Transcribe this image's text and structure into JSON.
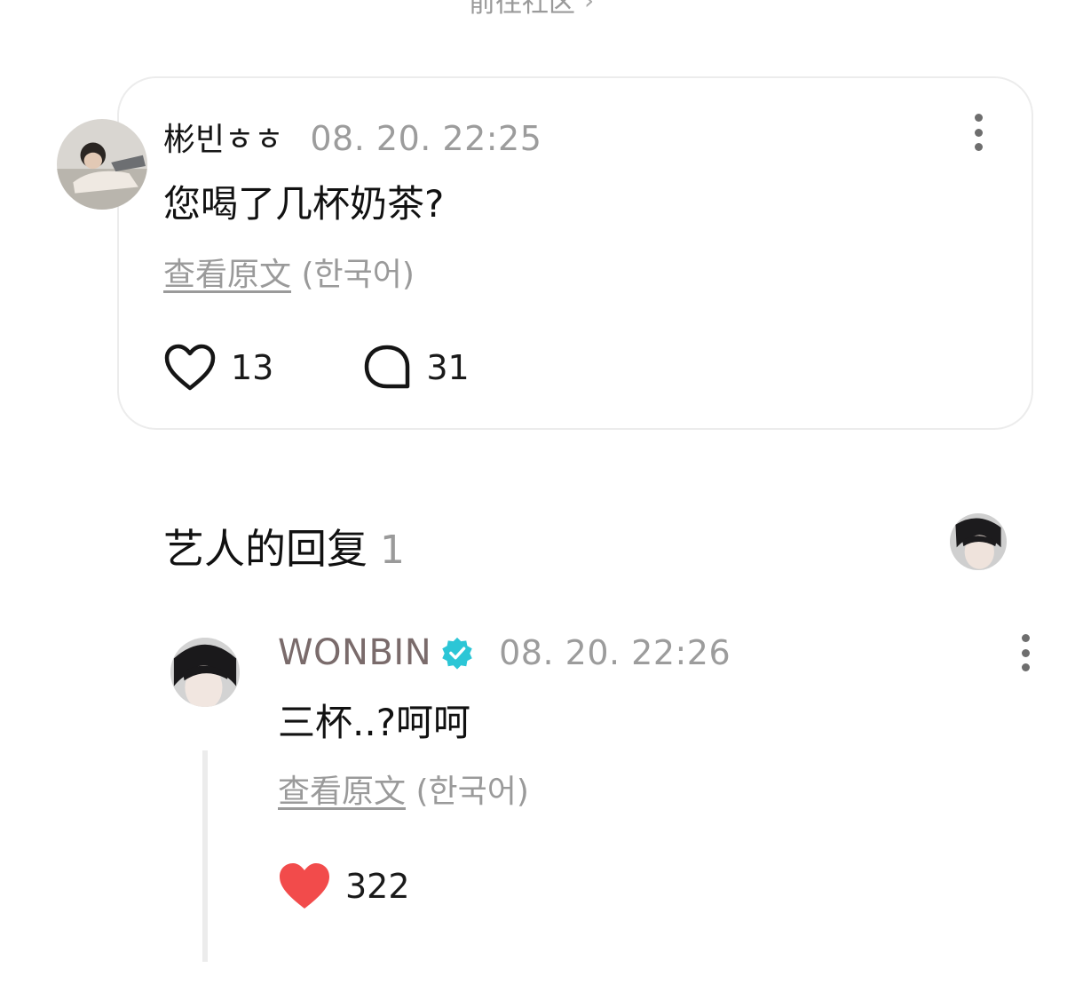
{
  "top_link": {
    "label": "前往社区",
    "chevron": "›"
  },
  "post": {
    "author": "彬빈ㅎㅎ",
    "time": "08. 20. 22:25",
    "text": "您喝了几杯奶茶?",
    "translate": {
      "link": "查看原文",
      "lang": "(한국어)"
    },
    "likes": "13",
    "comments": "31",
    "icons": {
      "like": "heart-outline-icon",
      "comment": "speech-bubble-icon",
      "menu": "kebab-menu-icon"
    }
  },
  "artist_replies": {
    "title": "艺人的回复",
    "count": "1"
  },
  "reply": {
    "author": "WONBIN",
    "time": "08. 20. 22:26",
    "text": "三杯..?呵呵",
    "translate": {
      "link": "查看原文",
      "lang": "(한국어)"
    },
    "likes": "322",
    "icons": {
      "like": "heart-filled-icon",
      "verified": "verified-badge-icon",
      "menu": "kebab-menu-icon"
    }
  },
  "colors": {
    "heart_filled": "#f24b4b",
    "verified": "#2cc6d6",
    "muted_text": "#9a9a9a",
    "artist_name": "#7a6b6b"
  }
}
